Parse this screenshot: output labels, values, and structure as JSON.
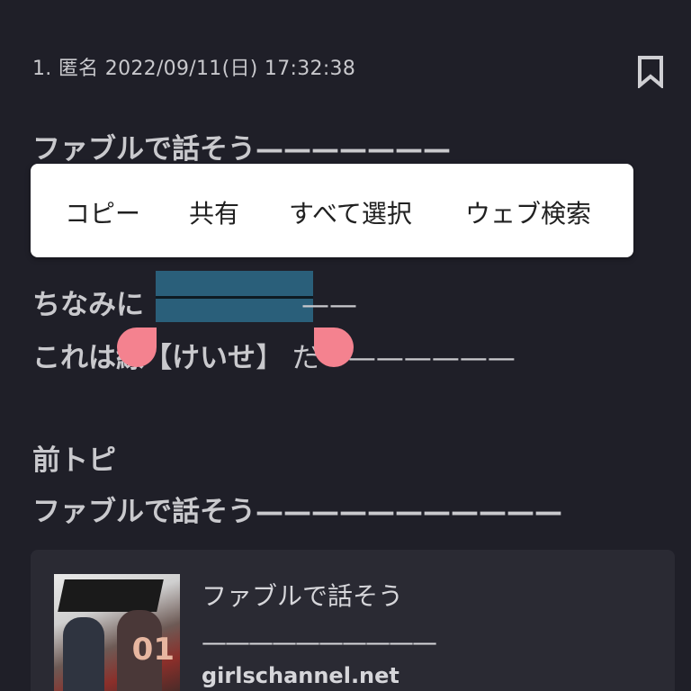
{
  "comment": {
    "meta": "1. 匿名 2022/09/11(日) 17:32:38",
    "lines": [
      "ファブルで話そう———————",
      "ちなみに",
      "これは",
      "前トピ",
      "ファブルで話そう———————————"
    ],
    "line3_tail": "——",
    "line4_middle": "線【けいせ",
    "line4_tail": "】 だ———————",
    "icons": {
      "bookmark": "bookmark-icon"
    }
  },
  "context_menu": {
    "items": [
      "コピー",
      "共有",
      "すべて選択",
      "ウェブ検索"
    ]
  },
  "selection": {
    "highlight_color": "#2a5f7a",
    "handle_color": "#f4828f"
  },
  "link_card": {
    "title": "ファブルで話そう",
    "rule": "——————————",
    "domain": "girlschannel.net"
  },
  "colors": {
    "background": "#1f1f28",
    "text": "#c9c9cd",
    "card_background": "#2a2a33",
    "menu_background": "#ffffff"
  }
}
